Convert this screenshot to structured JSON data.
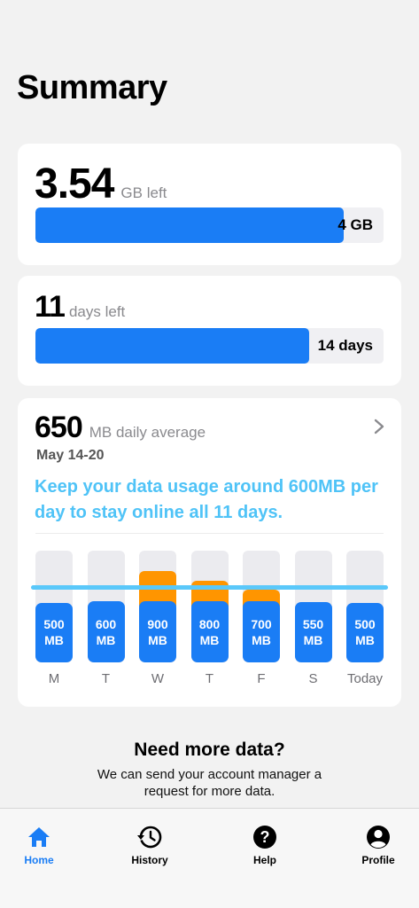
{
  "page": {
    "title": "Summary"
  },
  "data_card": {
    "remaining_value": "3.54",
    "remaining_unit": "GB left",
    "total_label": "4 GB",
    "remaining_fraction": 0.885
  },
  "days_card": {
    "remaining_value": "11",
    "remaining_unit": "days left",
    "total_label": "14 days",
    "remaining_fraction": 0.786
  },
  "usage_card": {
    "average_value": "650",
    "average_unit": "MB daily average",
    "date_range": "May 14-20",
    "advice": "Keep your data usage around 600MB per day to stay online all 11 days.",
    "target_mb": 600,
    "days": [
      {
        "day": "M",
        "mb": 500,
        "value": "500",
        "unit": "MB"
      },
      {
        "day": "T",
        "mb": 600,
        "value": "600",
        "unit": "MB"
      },
      {
        "day": "W",
        "mb": 900,
        "value": "900",
        "unit": "MB"
      },
      {
        "day": "T",
        "mb": 800,
        "value": "800",
        "unit": "MB"
      },
      {
        "day": "F",
        "mb": 700,
        "value": "700",
        "unit": "MB"
      },
      {
        "day": "S",
        "mb": 550,
        "value": "550",
        "unit": "MB"
      },
      {
        "day": "Today",
        "mb": 500,
        "value": "500",
        "unit": "MB"
      }
    ]
  },
  "more_data": {
    "title": "Need more data?",
    "text": "We can send your account manager a request for more data."
  },
  "tabbar": {
    "items": [
      {
        "label": "Home",
        "icon": "home-icon",
        "active": true
      },
      {
        "label": "History",
        "icon": "history-icon",
        "active": false
      },
      {
        "label": "Help",
        "icon": "help-icon",
        "active": false
      },
      {
        "label": "Profile",
        "icon": "profile-icon",
        "active": false
      }
    ]
  },
  "colors": {
    "accent": "#1a7df5",
    "over": "#ff9500",
    "target": "#5ac8fa",
    "advice": "#4fc3f7"
  }
}
